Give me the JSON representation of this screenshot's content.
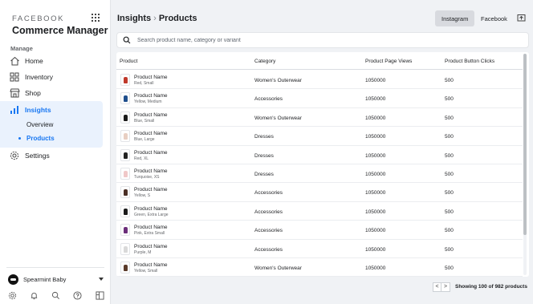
{
  "sidebar": {
    "brand": "FACEBOOK",
    "app_title": "Commerce Manager",
    "section_label": "Manage",
    "nav": [
      {
        "label": "Home",
        "icon": "home-icon"
      },
      {
        "label": "Inventory",
        "icon": "inventory-icon"
      },
      {
        "label": "Shop",
        "icon": "shop-icon"
      },
      {
        "label": "Insights",
        "icon": "insights-bar-chart-icon"
      },
      {
        "label": "Settings",
        "icon": "gear-icon"
      }
    ],
    "sub_items": [
      {
        "label": "Overview"
      },
      {
        "label": "Products"
      }
    ],
    "account_name": "Spearmint Baby",
    "footer_icons": [
      "settings-icon",
      "bell-icon",
      "search-icon",
      "help-icon",
      "panel-toggle-icon"
    ]
  },
  "header": {
    "title": "Insights",
    "subtitle": "Products",
    "toggle_instagram": "Instagram",
    "toggle_facebook": "Facebook",
    "export_icon": "export-icon"
  },
  "search": {
    "placeholder": "Search product name, category or variant"
  },
  "table": {
    "columns": [
      "Product",
      "Category",
      "Product Page Views",
      "Product Button Clicks"
    ],
    "rows": [
      {
        "name": "Product Name",
        "variant": "Red, Small",
        "category": "Women's Outerwear",
        "views": "1050000",
        "clicks": "500",
        "color": "#c0392b"
      },
      {
        "name": "Product Name",
        "variant": "Yellow, Medium",
        "category": "Accessories",
        "views": "1050000",
        "clicks": "500",
        "color": "#1f4e8c"
      },
      {
        "name": "Product Name",
        "variant": "Blue, Small",
        "category": "Women's Outerwear",
        "views": "1050000",
        "clicks": "500",
        "color": "#1a1a1a"
      },
      {
        "name": "Product Name",
        "variant": "Blue, Large",
        "category": "Dresses",
        "views": "1050000",
        "clicks": "500",
        "color": "#e8cfc2"
      },
      {
        "name": "Product Name",
        "variant": "Red, XL",
        "category": "Dresses",
        "views": "1050000",
        "clicks": "500",
        "color": "#222222"
      },
      {
        "name": "Product Name",
        "variant": "Turquoise, XS",
        "category": "Dresses",
        "views": "1050000",
        "clicks": "500",
        "color": "#f0c8c8"
      },
      {
        "name": "Product Name",
        "variant": "Yellow, S",
        "category": "Accessories",
        "views": "1050000",
        "clicks": "500",
        "color": "#4a2f25"
      },
      {
        "name": "Product Name",
        "variant": "Green, Extra Large",
        "category": "Accessories",
        "views": "1050000",
        "clicks": "500",
        "color": "#1a1a1a"
      },
      {
        "name": "Product Name",
        "variant": "Pink, Extra Small",
        "category": "Accessories",
        "views": "1050000",
        "clicks": "500",
        "color": "#6b2d7a"
      },
      {
        "name": "Product Name",
        "variant": "Purple, M",
        "category": "Accessories",
        "views": "1050000",
        "clicks": "500",
        "color": "#d9d9d9"
      },
      {
        "name": "Product Name",
        "variant": "Yellow, Small",
        "category": "Women's Outerwear",
        "views": "1050000",
        "clicks": "500",
        "color": "#5a3a2a"
      }
    ]
  },
  "pagination": {
    "prev": "<",
    "next": ">",
    "summary": "Showing 100 of 982 products"
  },
  "colors": {
    "accent": "#1877f2",
    "active_bg": "#eaf2fd"
  }
}
